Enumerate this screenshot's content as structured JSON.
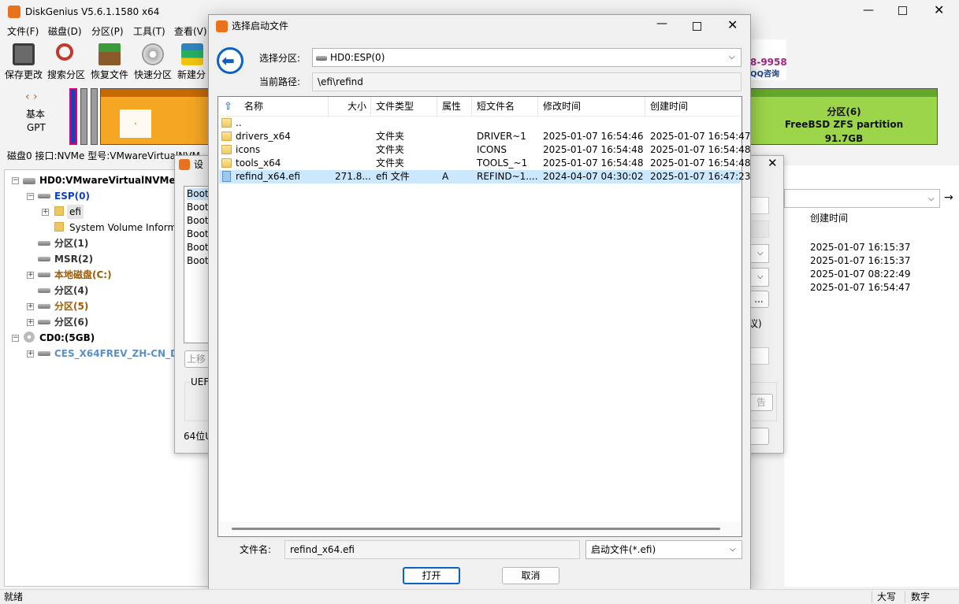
{
  "app": {
    "title": "DiskGenius V5.6.1.1580 x64",
    "menu": [
      "文件(F)",
      "磁盘(D)",
      "分区(P)",
      "工具(T)",
      "查看(V)"
    ],
    "toolbar": [
      "保存更改",
      "搜索分区",
      "恢复文件",
      "快速分区",
      "新建分"
    ],
    "ad_phone": "8-9958",
    "ad_qq": "QQ咨询"
  },
  "diskmap": {
    "type_label": "基本",
    "scheme": "GPT",
    "partition6": {
      "name": "分区(6)",
      "fs": "FreeBSD ZFS partition",
      "size": "91.7GB"
    }
  },
  "diskinfo": {
    "text": "磁盘0 接口:NVMe  型号:VMwareVirtualNVM"
  },
  "tree": {
    "disk0": "HD0:VMwareVirtualNVMeDi",
    "esp": "ESP(0)",
    "efi": "efi",
    "svi": "System Volume Informa",
    "p1": "分区(1)",
    "msr": "MSR(2)",
    "c": "本地磁盘(C:)",
    "p4": "分区(4)",
    "p5": "分区(5)",
    "p6": "分区(6)",
    "cd0": "CD0:(5GB)",
    "ces": "CES_X64FREV_ZH-CN_DVS"
  },
  "rightpane": {
    "header": "创建时间",
    "dates": [
      "2025-01-07 16:15:37",
      "2025-01-07 16:15:37",
      "2025-01-07 08:22:49",
      "2025-01-07 16:54:47"
    ]
  },
  "bgdialog": {
    "title": "设",
    "boot_items": [
      "Boot",
      "Boot",
      "Boot",
      "Boot",
      "Boot",
      "Boot"
    ],
    "move_up": "上移",
    "uefi_label": "UEF",
    "bottom_label": "64位U",
    "ellipsis": "...",
    "paren_fragment": "议)",
    "dim_fragment": "告"
  },
  "dialog": {
    "title": "选择启动文件",
    "partition_label": "选择分区:",
    "partition_value": "HD0:ESP(0)",
    "path_label": "当前路径:",
    "path_value": "\\efi\\refind",
    "columns": [
      "名称",
      "大小",
      "文件类型",
      "属性",
      "短文件名",
      "修改时间",
      "创建时间"
    ],
    "rows": [
      {
        "name": "..",
        "size": "",
        "type": "",
        "attr": "",
        "short": "",
        "mtime": "",
        "ctime": "",
        "kind": "up"
      },
      {
        "name": "drivers_x64",
        "size": "",
        "type": "文件夹",
        "attr": "",
        "short": "DRIVER~1",
        "mtime": "2025-01-07 16:54:46",
        "ctime": "2025-01-07 16:54:47",
        "kind": "folder"
      },
      {
        "name": "icons",
        "size": "",
        "type": "文件夹",
        "attr": "",
        "short": "ICONS",
        "mtime": "2025-01-07 16:54:48",
        "ctime": "2025-01-07 16:54:48",
        "kind": "folder"
      },
      {
        "name": "tools_x64",
        "size": "",
        "type": "文件夹",
        "attr": "",
        "short": "TOOLS_~1",
        "mtime": "2025-01-07 16:54:48",
        "ctime": "2025-01-07 16:54:48",
        "kind": "folder"
      },
      {
        "name": "refind_x64.efi",
        "size": "271.8...",
        "type": "efi 文件",
        "attr": "A",
        "short": "REFIND~1....",
        "mtime": "2024-04-07 04:30:02",
        "ctime": "2025-01-07 16:47:23",
        "kind": "file"
      }
    ],
    "filename_label": "文件名:",
    "filename_value": "refind_x64.efi",
    "filter_value": "启动文件(*.efi)",
    "ok": "打开",
    "cancel": "取消"
  },
  "status": {
    "left": "就绪",
    "caps": "大写",
    "num": "数字"
  },
  "colors": {
    "accent_blue": "#0b62c4",
    "selection": "#cce8ff",
    "partition_orange": "#f5a623",
    "zfs_green": "#9dd54a"
  }
}
